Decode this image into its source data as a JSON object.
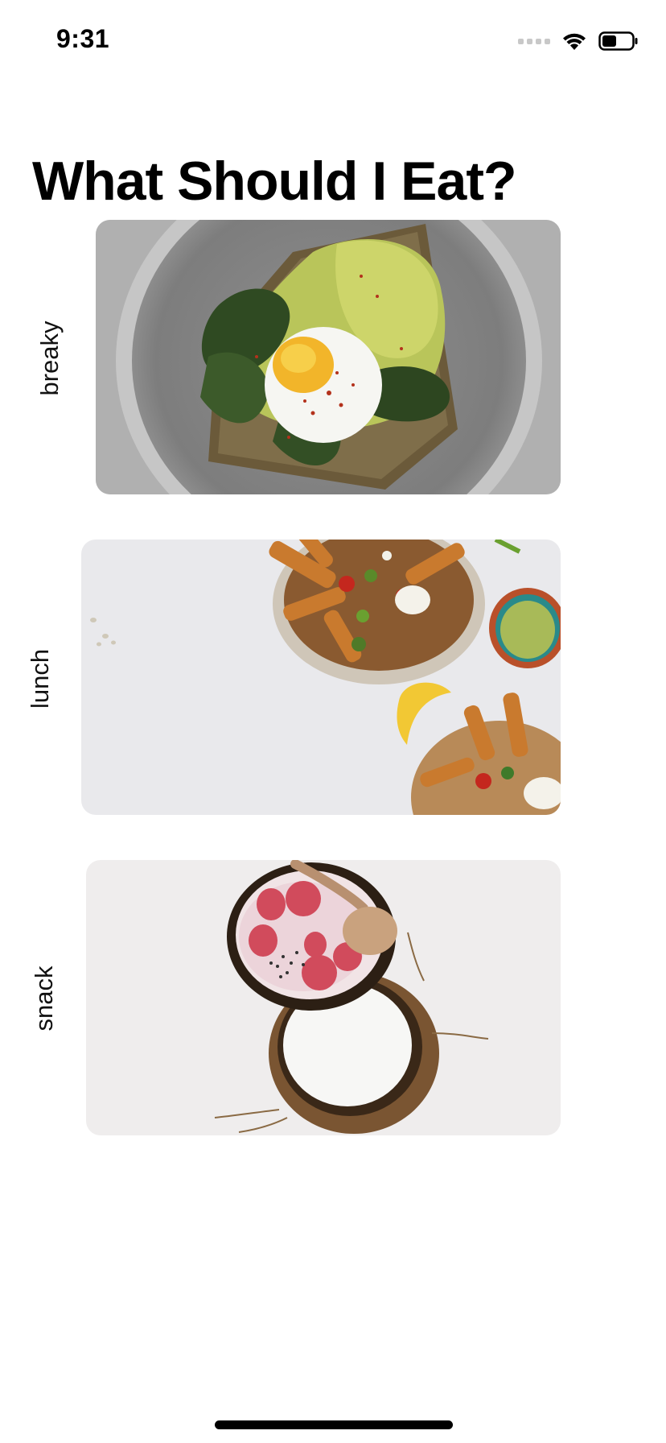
{
  "status_bar": {
    "time": "9:31"
  },
  "page": {
    "title": "What Should I Eat?"
  },
  "categories": [
    {
      "label": "breaky"
    },
    {
      "label": "lunch"
    },
    {
      "label": "snack"
    }
  ],
  "colors": {
    "background": "#ffffff",
    "text": "#000000",
    "home_indicator": "#000000"
  }
}
